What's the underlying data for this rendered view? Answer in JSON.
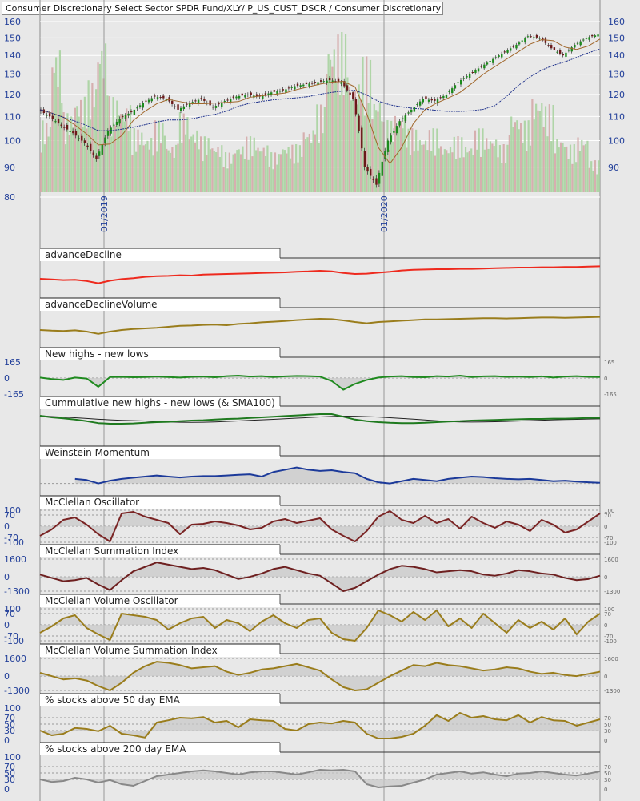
{
  "title": "Consumer Discretionary Select Sector SPDR Fund/XLY/ P_US_CUST_DSCR / Consumer Discretionary",
  "colors": {
    "background": "#e8e8e8",
    "up": "#1c8a1c",
    "down": "#8b1a1a",
    "sma_short": "#a0662a",
    "sma_long": "#1c2f8a",
    "axis_text": "#23409a"
  },
  "chart_data": [
    {
      "type": "line",
      "name": "price",
      "title": "Consumer Discretionary Select Sector SPDR Fund/XLY/ P_US_CUST_DSCR / Consumer Discretionary",
      "scale": "log",
      "ylim": [
        80,
        160
      ],
      "yticks": [
        160,
        150,
        140,
        130,
        120,
        110,
        100,
        90,
        80
      ],
      "yticks_right": [
        160,
        150,
        140,
        130,
        120,
        110,
        100,
        90
      ],
      "x_labels": [
        "01/2019",
        "01/2020"
      ],
      "close": [
        113,
        110,
        106,
        103,
        99,
        93,
        104,
        109,
        112,
        116,
        119,
        118,
        113,
        116,
        118,
        114,
        117,
        119,
        120,
        119,
        121,
        122,
        124,
        125,
        126,
        127,
        126,
        118,
        90,
        84,
        100,
        108,
        113,
        118,
        117,
        120,
        126,
        130,
        134,
        138,
        142,
        146,
        151,
        150,
        144,
        140,
        146,
        150,
        152
      ],
      "volume": [
        0.45,
        0.9,
        0.5,
        0.6,
        0.7,
        0.95,
        0.6,
        0.55,
        0.4,
        0.35,
        0.45,
        0.3,
        0.5,
        0.4,
        0.35,
        0.3,
        0.25,
        0.3,
        0.35,
        0.3,
        0.25,
        0.3,
        0.3,
        0.4,
        0.55,
        0.95,
        1.0,
        0.7,
        0.85,
        0.6,
        0.45,
        0.5,
        0.4,
        0.35,
        0.4,
        0.3,
        0.35,
        0.3,
        0.4,
        0.35,
        0.3,
        0.5,
        0.45,
        0.6,
        0.55,
        0.35,
        0.3,
        0.35,
        0.2
      ]
    }
  ],
  "panels": [
    {
      "title": "advanceDecline",
      "color": "#ee2a1e",
      "range": [
        0,
        10
      ],
      "left_labels": [],
      "right_labels": [],
      "refs": [],
      "values": [
        5,
        4.8,
        4.6,
        4.7,
        4.3,
        3.6,
        4.4,
        4.9,
        5.2,
        5.6,
        5.8,
        5.9,
        6.1,
        6.0,
        6.3,
        6.4,
        6.5,
        6.6,
        6.7,
        6.8,
        6.9,
        7.0,
        7.2,
        7.3,
        7.5,
        7.3,
        6.8,
        6.5,
        6.6,
        6.9,
        7.2,
        7.6,
        7.8,
        7.9,
        8.0,
        8.0,
        8.1,
        8.1,
        8.2,
        8.3,
        8.4,
        8.5,
        8.5,
        8.6,
        8.6,
        8.7,
        8.7,
        8.8,
        8.9
      ]
    },
    {
      "title": "advanceDeclineVolume",
      "color": "#9a7d1c",
      "range": [
        0,
        10
      ],
      "left_labels": [],
      "right_labels": [],
      "refs": [],
      "values": [
        4.5,
        4.3,
        4.2,
        4.4,
        4.0,
        3.3,
        4.0,
        4.5,
        4.8,
        5.0,
        5.2,
        5.5,
        5.8,
        5.9,
        6.1,
        6.2,
        6.0,
        6.4,
        6.6,
        6.9,
        7.1,
        7.3,
        7.6,
        7.8,
        8.0,
        7.9,
        7.5,
        7.0,
        6.6,
        7.0,
        7.2,
        7.4,
        7.6,
        7.8,
        7.8,
        7.9,
        8.0,
        8.1,
        8.2,
        8.2,
        8.1,
        8.2,
        8.3,
        8.4,
        8.4,
        8.3,
        8.4,
        8.5,
        8.6
      ]
    },
    {
      "title": "New highs - new lows",
      "color": "#1f8a1f",
      "range": [
        -165,
        165
      ],
      "left_labels": [
        "165",
        "0",
        "-165"
      ],
      "right_labels": [
        "165",
        "0",
        "-165"
      ],
      "refs": [
        0
      ],
      "fill": 0,
      "values": [
        5,
        -10,
        -20,
        5,
        -5,
        -90,
        10,
        12,
        8,
        10,
        15,
        10,
        5,
        12,
        15,
        8,
        20,
        25,
        15,
        20,
        10,
        18,
        22,
        20,
        15,
        -30,
        -120,
        -60,
        -20,
        5,
        15,
        20,
        10,
        8,
        20,
        15,
        25,
        10,
        18,
        20,
        12,
        15,
        10,
        18,
        5,
        15,
        20,
        12,
        10
      ]
    },
    {
      "title": "Cummulative new highs - new lows (& SMA100)",
      "color": "#1f7a1f",
      "sma": "#222",
      "range": [
        0,
        10
      ],
      "left_labels": [],
      "right_labels": [],
      "refs": [],
      "values": [
        8.5,
        8.0,
        7.7,
        7.3,
        6.8,
        6.2,
        6.0,
        6.0,
        6.1,
        6.3,
        6.5,
        6.6,
        6.8,
        7.0,
        7.1,
        7.3,
        7.5,
        7.6,
        7.8,
        8.0,
        8.2,
        8.4,
        8.6,
        8.8,
        9.0,
        9.0,
        8.2,
        7.3,
        6.8,
        6.5,
        6.3,
        6.2,
        6.2,
        6.3,
        6.5,
        6.7,
        6.8,
        7.0,
        7.1,
        7.2,
        7.3,
        7.4,
        7.5,
        7.5,
        7.6,
        7.6,
        7.7,
        7.8,
        7.8
      ]
    },
    {
      "title": "Weinstein Momentum",
      "color": "#1c3a9a",
      "range": [
        -4,
        10
      ],
      "left_labels": [],
      "right_labels": [],
      "refs": [
        0
      ],
      "fill": 0,
      "values": [
        null,
        null,
        null,
        2,
        1.5,
        0,
        1.2,
        2,
        2.5,
        3,
        3.5,
        3,
        2.6,
        3,
        3.2,
        3.2,
        3.5,
        3.8,
        4,
        3,
        5,
        6,
        7,
        6,
        5.5,
        5.8,
        5,
        4.5,
        2,
        0.5,
        0,
        1,
        2,
        1.5,
        1,
        2,
        2.5,
        3,
        2.8,
        2.3,
        2,
        1.8,
        2,
        1.5,
        1,
        1.2,
        0.8,
        0.5,
        0.3
      ]
    },
    {
      "title": "McClellan Oscillator",
      "color": "#7a2424",
      "range": [
        -100,
        100
      ],
      "left_labels": [
        "100",
        "70",
        "0",
        "-70",
        "-100"
      ],
      "right_labels": [
        "100",
        "70",
        "0",
        "-70",
        "-100"
      ],
      "refs": [
        100,
        70,
        0,
        -70,
        -100
      ],
      "fill": 0,
      "values": [
        -60,
        -20,
        40,
        55,
        10,
        -50,
        -95,
        80,
        90,
        60,
        40,
        20,
        -50,
        10,
        15,
        30,
        20,
        5,
        -20,
        -10,
        30,
        45,
        20,
        35,
        50,
        -20,
        -60,
        -95,
        -30,
        60,
        95,
        40,
        20,
        65,
        20,
        45,
        -15,
        60,
        20,
        -10,
        30,
        10,
        -30,
        40,
        10,
        -40,
        -20,
        30,
        80
      ]
    },
    {
      "title": "McClellan Summation Index",
      "color": "#6e2020",
      "range": [
        -1300,
        1600
      ],
      "left_labels": [
        "1600",
        "0",
        "-1300"
      ],
      "right_labels": [
        "1600",
        "0",
        "-1300"
      ],
      "refs": [
        1600,
        0,
        -1300
      ],
      "fill": 0,
      "values": [
        200,
        -100,
        -400,
        -300,
        -100,
        -700,
        -1200,
        -300,
        500,
        900,
        1300,
        1100,
        900,
        700,
        800,
        600,
        200,
        -200,
        0,
        300,
        700,
        900,
        600,
        300,
        100,
        -600,
        -1300,
        -1000,
        -400,
        200,
        700,
        1000,
        900,
        700,
        400,
        500,
        600,
        500,
        200,
        100,
        300,
        600,
        500,
        300,
        200,
        -100,
        -300,
        -200,
        100
      ]
    },
    {
      "title": "McClellan Volume Oscillator",
      "color": "#9a7d1c",
      "range": [
        -100,
        100
      ],
      "left_labels": [
        "100",
        "70",
        "0",
        "-70",
        "-100"
      ],
      "right_labels": [
        "100",
        "70",
        "0",
        "-70",
        "-100"
      ],
      "refs": [
        100,
        70,
        0,
        -70,
        -100
      ],
      "fill": 0,
      "values": [
        -50,
        -10,
        40,
        60,
        -20,
        -60,
        -95,
        70,
        60,
        50,
        30,
        -30,
        10,
        40,
        50,
        -20,
        30,
        10,
        -40,
        20,
        60,
        10,
        -20,
        30,
        40,
        -50,
        -90,
        -100,
        -20,
        90,
        60,
        20,
        80,
        30,
        90,
        -10,
        40,
        -20,
        70,
        10,
        -50,
        30,
        -20,
        20,
        -30,
        40,
        -60,
        20,
        70
      ]
    },
    {
      "title": "McClellan Volume Summation Index",
      "color": "#9a7d1c",
      "range": [
        -1300,
        1600
      ],
      "left_labels": [
        "1600",
        "0",
        "-1300"
      ],
      "right_labels": [
        "1600",
        "0",
        "-1300"
      ],
      "refs": [
        1600,
        0,
        -1300
      ],
      "fill": 0,
      "values": [
        300,
        0,
        -300,
        -200,
        -400,
        -900,
        -1300,
        -600,
        300,
        900,
        1300,
        1200,
        1000,
        700,
        800,
        900,
        400,
        100,
        300,
        600,
        700,
        900,
        1100,
        800,
        500,
        -300,
        -1000,
        -1300,
        -1200,
        -600,
        0,
        500,
        1000,
        900,
        1200,
        1000,
        900,
        700,
        500,
        600,
        800,
        700,
        400,
        200,
        300,
        100,
        0,
        200,
        400
      ]
    },
    {
      "title": "% stocks above 50 day EMA",
      "color": "#9a7d1c",
      "range": [
        0,
        100
      ],
      "left_labels": [
        "100",
        "70",
        "50",
        "30",
        "0"
      ],
      "right_labels": [
        "70",
        "50",
        "30",
        "0"
      ],
      "refs": [
        70,
        50,
        30
      ],
      "fill": 30,
      "values": [
        30,
        15,
        20,
        38,
        35,
        28,
        45,
        20,
        15,
        8,
        55,
        62,
        70,
        68,
        72,
        55,
        60,
        40,
        65,
        62,
        60,
        35,
        30,
        50,
        55,
        52,
        60,
        55,
        20,
        5,
        5,
        10,
        20,
        45,
        78,
        60,
        85,
        70,
        75,
        65,
        62,
        78,
        55,
        72,
        62,
        60,
        45,
        55,
        65
      ]
    },
    {
      "title": "% stocks above 200 day EMA",
      "color": "#888888",
      "range": [
        0,
        100
      ],
      "left_labels": [
        "100",
        "70",
        "50",
        "30",
        "0"
      ],
      "right_labels": [
        "70",
        "50",
        "30",
        "0"
      ],
      "refs": [
        70,
        50,
        30
      ],
      "fill": 30,
      "values": [
        30,
        22,
        25,
        35,
        30,
        20,
        28,
        15,
        10,
        25,
        40,
        45,
        50,
        55,
        58,
        55,
        50,
        45,
        52,
        55,
        55,
        50,
        45,
        52,
        60,
        58,
        60,
        55,
        15,
        5,
        8,
        10,
        20,
        30,
        45,
        50,
        55,
        48,
        52,
        45,
        40,
        48,
        50,
        55,
        50,
        45,
        42,
        48,
        55
      ]
    }
  ]
}
